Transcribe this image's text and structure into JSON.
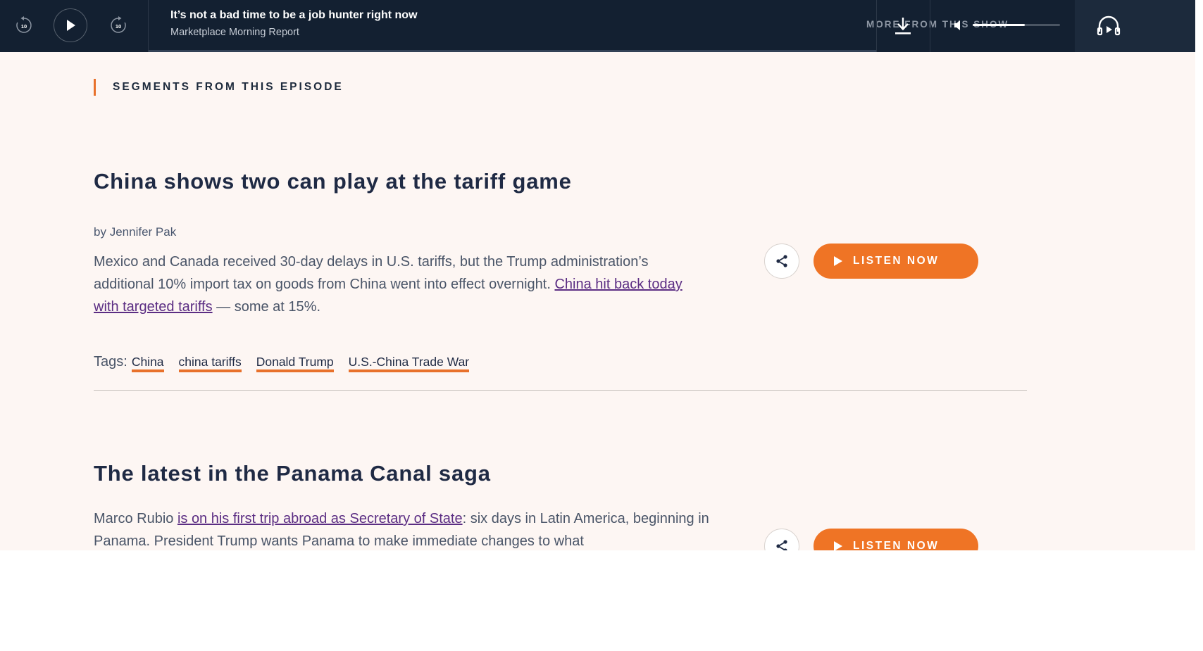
{
  "player": {
    "skip_back_seconds": "10",
    "skip_forward_seconds": "10",
    "episode_title": "It’s not a bad time to be a job hunter right now",
    "show_name": "Marketplace Morning Report",
    "more_from_show": "MORE FROM THIS SHOW",
    "volume_level": 0.6,
    "playback_progress": 0.0
  },
  "main": {
    "section_heading": "SEGMENTS FROM THIS EPISODE",
    "segments": [
      {
        "title": "China shows two can play at the tariff game",
        "byline_prefix": "by",
        "author": "Jennifer Pak",
        "desc_text_1": "Mexico and Canada received 30-day delays in U.S. tariffs, but the Trump administration’s additional 10% import tax on goods from China went into effect overnight.",
        "desc_link": "China hit back today with targeted tariffs",
        "desc_text_2": " — some at 15%.",
        "tags_label": "Tags:",
        "tags": [
          "China",
          "china tariffs",
          "Donald Trump",
          "U.S.-China Trade War"
        ],
        "listen_label": "LISTEN NOW"
      },
      {
        "title": "The latest in the Panama Canal saga",
        "desc_text_1": "Marco Rubio ",
        "desc_link": "is on his first trip abroad as Secretary of State",
        "desc_text_2": ": six days in Latin America, beginning in Panama. President Trump wants Panama to make immediate changes to what",
        "listen_label": "LISTEN NOW"
      }
    ]
  },
  "colors": {
    "player_bg": "#132031",
    "page_bg": "#fdf6f3",
    "accent": "#ef7425",
    "title_text": "#1f2a44",
    "link": "#5b2d83"
  },
  "icons": [
    "skip-back-10-icon",
    "play-icon",
    "skip-forward-10-icon",
    "download-icon",
    "volume-icon",
    "headphones-play-icon",
    "share-icon"
  ]
}
